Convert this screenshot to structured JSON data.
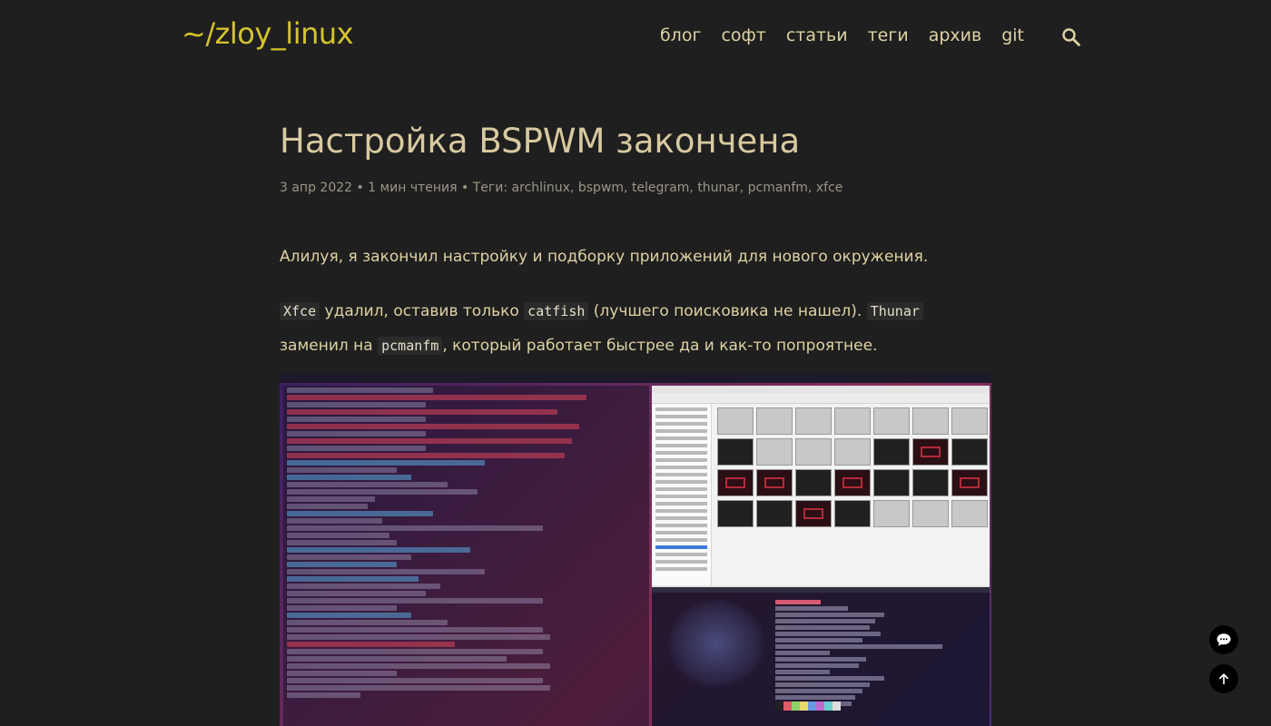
{
  "site": {
    "logo": "~/zloy_linux",
    "nav": [
      "блог",
      "софт",
      "статьи",
      "теги",
      "архив",
      "git"
    ],
    "accent_color": "#d4c32e",
    "search_icon": "search-icon"
  },
  "post": {
    "title": "Настройка BSPWM закончена",
    "meta": {
      "date": "3 апр 2022",
      "sep1": " • ",
      "read_time": "1 мин чтения",
      "sep2": " • ",
      "tags_label": "Теги: ",
      "tags": [
        "archlinux",
        "bspwm",
        "telegram",
        "thunar",
        "pcmanfm",
        "xfce"
      ]
    },
    "paragraph1": "Алилуя, я закончил настройку и подборку приложений для нового окружения.",
    "paragraph2": {
      "code1": "Xfce",
      "t1": " удалил, оставив только ",
      "code2": "catfish",
      "t2": " (лучшего поисковика не нашел). ",
      "code3": "Thunar",
      "t3": " заменил на ",
      "code4": "pcmanfm",
      "t4": ", который работает быстрее да и как-то попроятнее."
    }
  },
  "fabs": {
    "comments_icon": "comment-icon",
    "top_icon": "arrow-up-icon"
  }
}
